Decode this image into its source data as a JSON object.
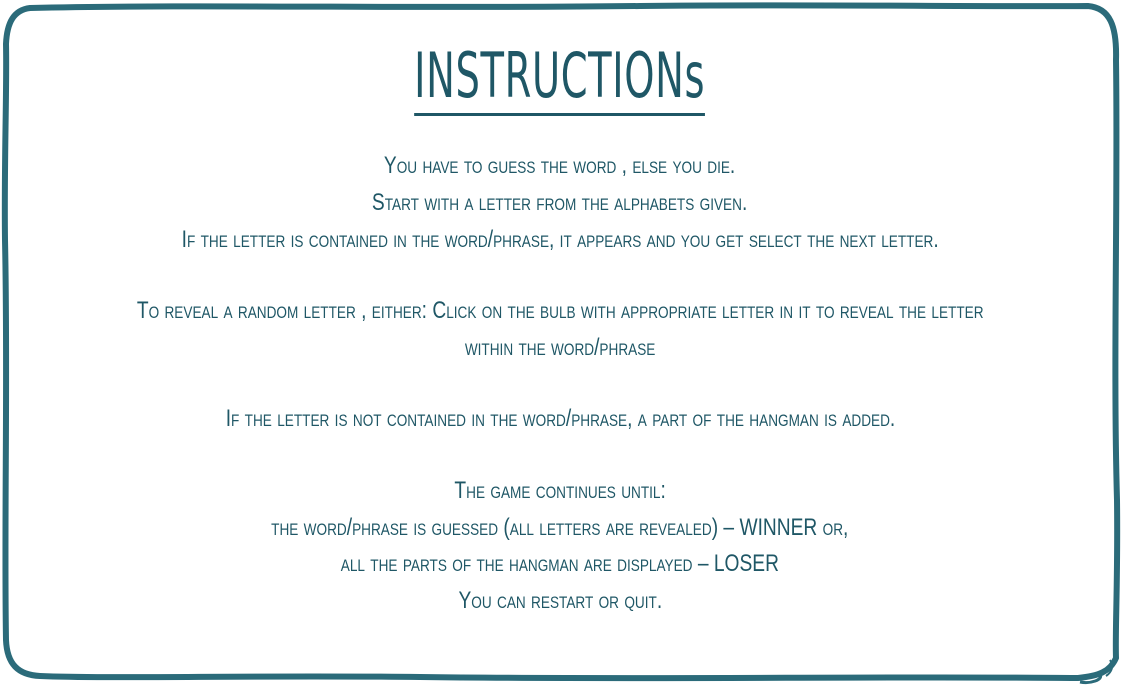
{
  "title": "INSTRUCTIONs",
  "paragraphs": [
    [
      "You have to guess the word , else you die.",
      "Start with a letter from the alphabets given.",
      "If the letter is contained in the word/phrase, it appears and you get select the next letter."
    ],
    [
      "To reveal a random letter , either: Click on the bulb with appropriate letter in it to reveal the letter",
      "within the word/phrase"
    ],
    [
      "If the letter is not contained in the word/phrase, a part of the hangman is added."
    ],
    [
      "The game continues until:",
      "the word/phrase is guessed (all letters are revealed) – WINNER or,",
      "all the parts of the hangman are displayed – LOSER",
      "You can restart or quit."
    ]
  ],
  "colors": {
    "text": "#1f5766",
    "border": "#2b6b7a",
    "background": "#ffffff"
  }
}
